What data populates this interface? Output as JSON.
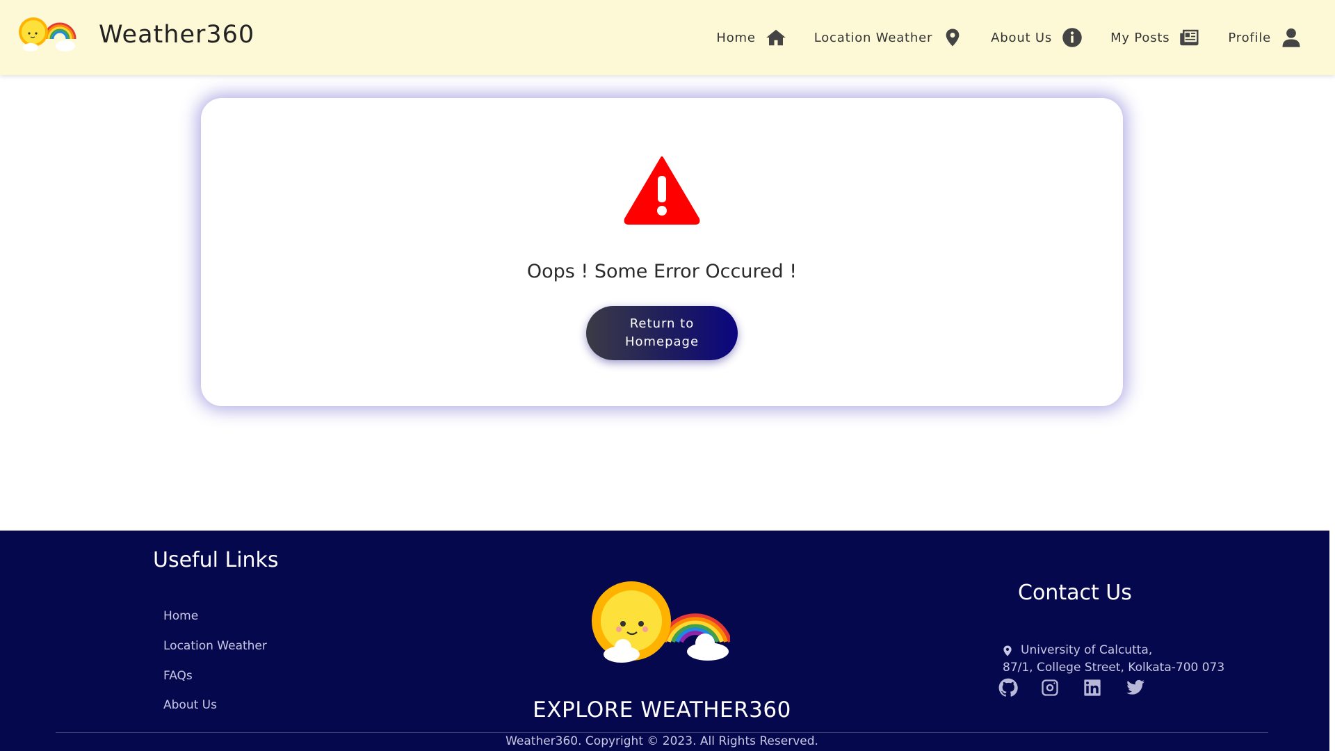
{
  "header": {
    "brand": "Weather360",
    "nav": [
      {
        "label": "Home",
        "icon": "home-icon"
      },
      {
        "label": "Location Weather",
        "icon": "map-pin-icon"
      },
      {
        "label": "About Us",
        "icon": "info-icon"
      },
      {
        "label": "My Posts",
        "icon": "newspaper-icon"
      },
      {
        "label": "Profile",
        "icon": "user-icon"
      }
    ]
  },
  "error": {
    "message": "Oops ! Some Error Occured !",
    "button_label": "Return to Homepage",
    "icon": "warning-icon"
  },
  "footer": {
    "links_title": "Useful Links",
    "links": [
      "Home",
      "Location Weather",
      "FAQs",
      "About Us"
    ],
    "explore": "EXPLORE WEATHER360",
    "contact_title": "Contact Us",
    "address_line1": "University of Calcutta,",
    "address_line2": "87/1, College Street, Kolkata-700 073",
    "socials": [
      "github-icon",
      "instagram-icon",
      "linkedin-icon",
      "twitter-icon"
    ],
    "copyright": "Weather360. Copyright © 2023. All Rights Reserved."
  },
  "colors": {
    "header_bg": "#fdf9d6",
    "footer_bg": "#06084d",
    "warning_red": "#ff0000",
    "button_start": "#3b3b46",
    "button_end": "#0b0680"
  }
}
